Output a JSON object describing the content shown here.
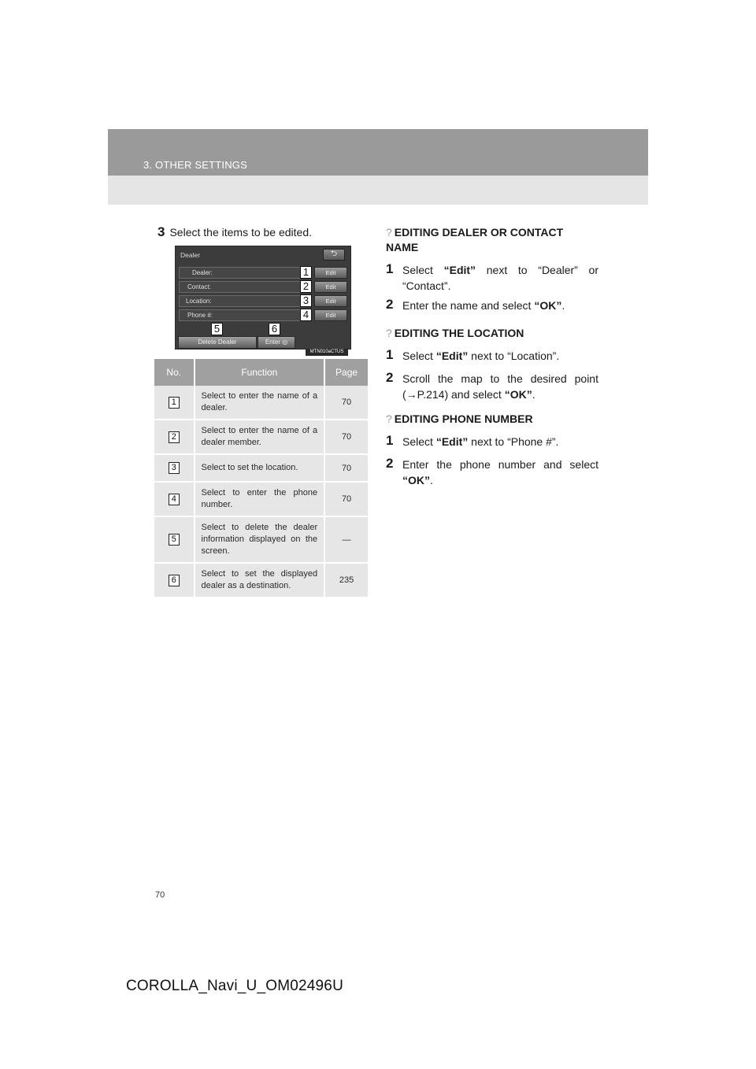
{
  "header": {
    "section_title": "3. OTHER SETTINGS"
  },
  "step3": {
    "number": "3",
    "text": "Select the items to be edited."
  },
  "screenshot": {
    "title": "Dealer",
    "back_icon": "back-arrow-icon",
    "rows": [
      {
        "label": "Dealer:",
        "badge": "1",
        "button": "Edit"
      },
      {
        "label": "Contact:",
        "badge": "2",
        "button": "Edit"
      },
      {
        "label": "Location:",
        "badge": "3",
        "button": "Edit"
      },
      {
        "label": "Phone #:",
        "badge": "4",
        "button": "Edit"
      }
    ],
    "delete_button": {
      "label": "Delete Dealer",
      "badge": "5"
    },
    "enter_button": {
      "label": "Enter",
      "badge": "6"
    },
    "image_code": "MTN010aCTUS"
  },
  "table": {
    "headers": [
      "No.",
      "Function",
      "Page"
    ],
    "rows": [
      {
        "no": "1",
        "function": "Select to enter the name of a dealer.",
        "page": "70"
      },
      {
        "no": "2",
        "function": "Select to enter the name of a dealer member.",
        "page": "70"
      },
      {
        "no": "3",
        "function": "Select to set the location.",
        "page": "70"
      },
      {
        "no": "4",
        "function": "Select to enter the phone number.",
        "page": "70"
      },
      {
        "no": "5",
        "function": "Select to delete the dealer information displayed on the screen.",
        "page": "—"
      },
      {
        "no": "6",
        "function": "Select to set the displayed dealer as a destination.",
        "page": "235"
      }
    ]
  },
  "sections": [
    {
      "marker": "?",
      "title": "EDITING DEALER OR CONTACT NAME",
      "steps": [
        {
          "n": "1",
          "pre": "Select ",
          "bold": "“Edit”",
          "post": " next to “Dealer” or “Contact”."
        },
        {
          "n": "2",
          "pre": "Enter the name and select ",
          "bold": "“OK”",
          "post": "."
        }
      ]
    },
    {
      "marker": "?",
      "title": "EDITING THE LOCATION",
      "steps": [
        {
          "n": "1",
          "pre": "Select ",
          "bold": "“Edit”",
          "post": " next to “Location”."
        },
        {
          "n": "2",
          "pre": "Scroll the map to the desired point (→P.214) and select ",
          "bold": "“OK”",
          "post": "."
        }
      ]
    },
    {
      "marker": "?",
      "title": "EDITING PHONE NUMBER",
      "steps": [
        {
          "n": "1",
          "pre": "Select ",
          "bold": "“Edit”",
          "post": " next to “Phone #”."
        },
        {
          "n": "2",
          "pre": "Enter the phone number and select ",
          "bold": "“OK”",
          "post": "."
        }
      ]
    }
  ],
  "page_number": "70",
  "footer": "COROLLA_Navi_U_OM02496U"
}
